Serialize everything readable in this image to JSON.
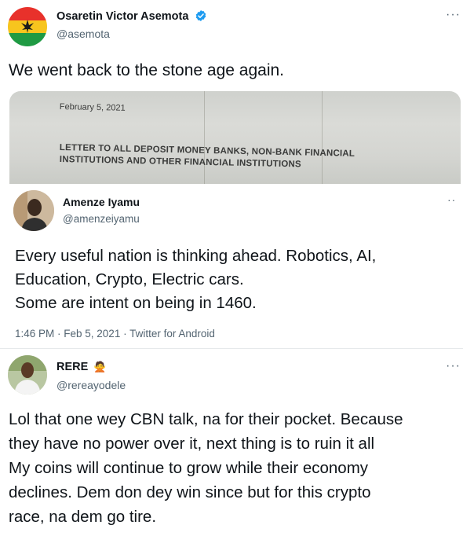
{
  "tweet1": {
    "display_name": "Osaretin Victor Asemota",
    "handle": "@asemota",
    "text": "We went back to the stone age again.",
    "more": "···",
    "avatar_colors": [
      "#e8312b",
      "#f7c51e",
      "#1f9a43"
    ]
  },
  "letter_image": {
    "date": "February 5, 2021",
    "line1": "LETTER TO ALL DEPOSIT MONEY BANKS, NON-BANK FINANCIAL",
    "line2": "INSTITUTIONS AND OTHER FINANCIAL INSTITUTIONS"
  },
  "tweet2": {
    "display_name": "Amenze Iyamu",
    "handle": "@amenzeiyamu",
    "more": "··",
    "text_lines": [
      "Every useful nation is thinking ahead. Robotics, AI,",
      "Education, Crypto, Electric cars.",
      "Some are intent on being in 1460."
    ],
    "meta": "1:46 PM · Feb 5, 2021 · Twitter for Android"
  },
  "tweet3": {
    "display_name": "RERE",
    "emoji": "🙅",
    "handle": "@rereayodele",
    "more": "···",
    "text_lines": [
      "Lol that one wey CBN talk, na for their pocket. Because",
      "they have no power over it, next thing is to ruin it all",
      "My coins will continue to grow while their economy",
      "declines. Dem don dey win since but for this crypto",
      "race, na dem go tire."
    ]
  },
  "colors": {
    "verified": "#1d9bf0",
    "text": "#0f1419",
    "muted": "#536471"
  }
}
